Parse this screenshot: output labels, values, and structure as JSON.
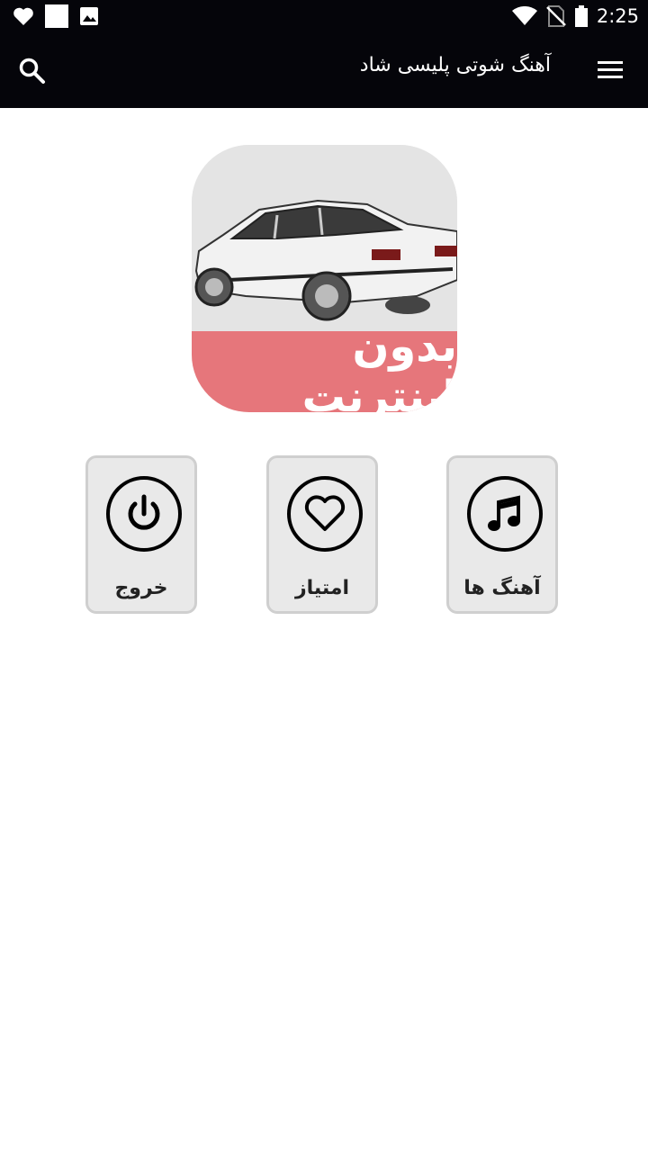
{
  "status_bar": {
    "time": "2:25",
    "icons": [
      "heart-notification-icon",
      "blank-notification-icon",
      "image-notification-icon",
      "wifi-icon",
      "no-sim-icon",
      "battery-icon"
    ]
  },
  "app_bar": {
    "title": "آهنگ شوتی پلیسی شاد",
    "search_icon": "search-icon",
    "menu_icon": "hamburger-menu-icon"
  },
  "logo": {
    "banner_text": "بدون اینترنت",
    "banner_color": "#e6767b"
  },
  "tiles": [
    {
      "label": "آهنگ ها",
      "icon": "music-note-icon"
    },
    {
      "label": "امتیاز",
      "icon": "heart-icon"
    },
    {
      "label": "خروج",
      "icon": "power-icon"
    }
  ]
}
